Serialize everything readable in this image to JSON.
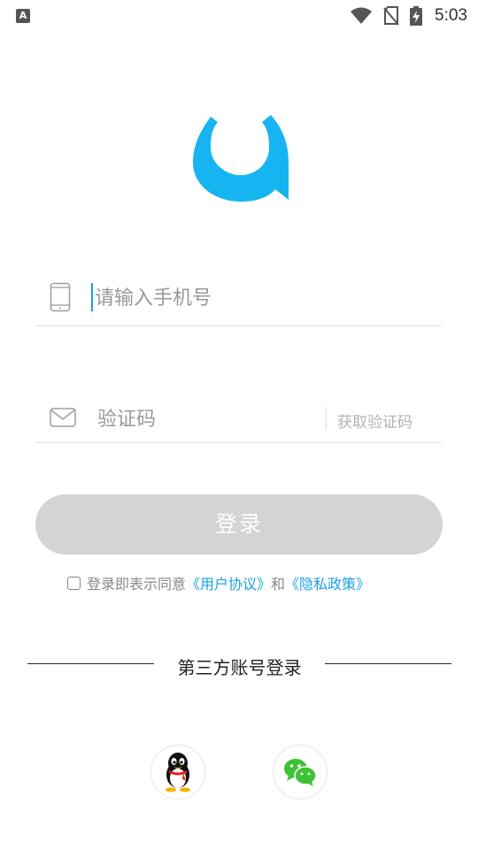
{
  "status_bar": {
    "notification_icon": "A",
    "time": "5:03"
  },
  "login": {
    "phone_placeholder": "请输入手机号",
    "code_placeholder": "验证码",
    "get_code_label": "获取验证码",
    "login_button": "登录"
  },
  "agreement": {
    "prefix": "登录即表示同意",
    "user_agreement": "《用户协议》",
    "conjunction": "和",
    "privacy_policy": "《隐私政策》",
    "checked": false
  },
  "third_party": {
    "title": "第三方账号登录",
    "providers": [
      "qq-icon",
      "wechat-icon"
    ]
  },
  "colors": {
    "brand": "#16B5F2",
    "link": "#1AA0E8",
    "button_disabled": "#D4D4D4",
    "caret": "#2196F3",
    "wechat": "#3DC235"
  }
}
